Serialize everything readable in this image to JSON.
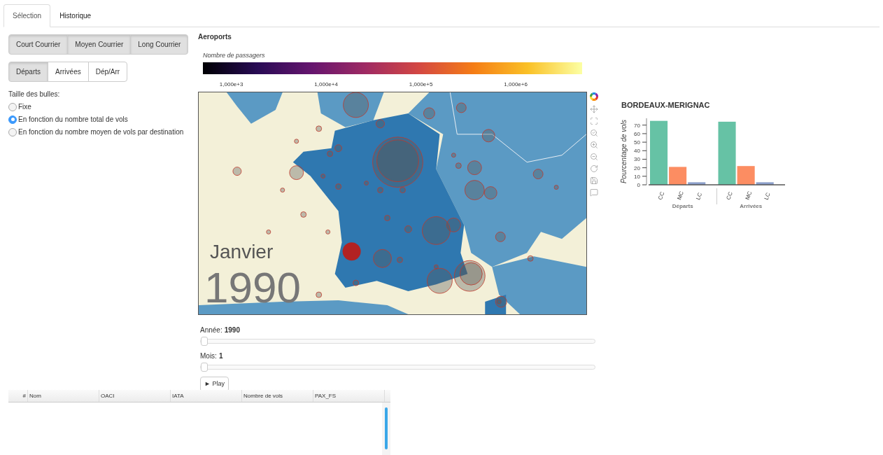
{
  "tabs": [
    {
      "label": "Sélection",
      "selected": true
    },
    {
      "label": "Historique",
      "selected": false
    }
  ],
  "haul_buttons": [
    {
      "label": "Court Courrier",
      "selected": true
    },
    {
      "label": "Moyen Courrier",
      "selected": true
    },
    {
      "label": "Long Courrier",
      "selected": true
    }
  ],
  "direction_buttons": [
    {
      "label": "Départs",
      "selected": true
    },
    {
      "label": "Arrivées",
      "selected": false
    },
    {
      "label": "Dép/Arr",
      "selected": false
    }
  ],
  "bubble_size": {
    "label": "Taille des bulles:",
    "options": [
      {
        "label": "Fixe",
        "selected": false
      },
      {
        "label": "En fonction du nombre total de vols",
        "selected": true
      },
      {
        "label": "En fonction du nombre moyen de vols par destination",
        "selected": false
      }
    ]
  },
  "map": {
    "title": "Aeroports",
    "colorbar": {
      "title": "Nombre de passagers",
      "ticks": [
        "1,000e+3",
        "1,000e+4",
        "1,000e+5",
        "1,000e+6"
      ]
    },
    "month_overlay": "Janvier",
    "year_overlay": "1990"
  },
  "chart": {
    "chart_data": {
      "type": "bar",
      "title": "BORDEAUX-MERIGNAC",
      "ylabel": "Pourcentage de vols",
      "categories": [
        "Départs",
        "Arrivées"
      ],
      "series": [
        {
          "name": "CC",
          "color": "#66c2a5",
          "values": [
            75,
            74
          ]
        },
        {
          "name": "MC",
          "color": "#fc8d62",
          "values": [
            21,
            22
          ]
        },
        {
          "name": "LC",
          "color": "#8da0cb",
          "values": [
            3,
            3
          ]
        }
      ],
      "yticks": [
        0,
        10,
        20,
        30,
        40,
        50,
        60,
        70
      ],
      "ylim": [
        0,
        78
      ]
    }
  },
  "sliders": [
    {
      "label": "Année:",
      "value": "1990",
      "level": 0
    },
    {
      "label": "Mois:",
      "value": "1",
      "level": 0
    }
  ],
  "play_button": "► Play",
  "table": {
    "columns": [
      "#",
      "Nom",
      "OACI",
      "IATA",
      "Nombre de vols",
      "PAX_FS"
    ]
  }
}
